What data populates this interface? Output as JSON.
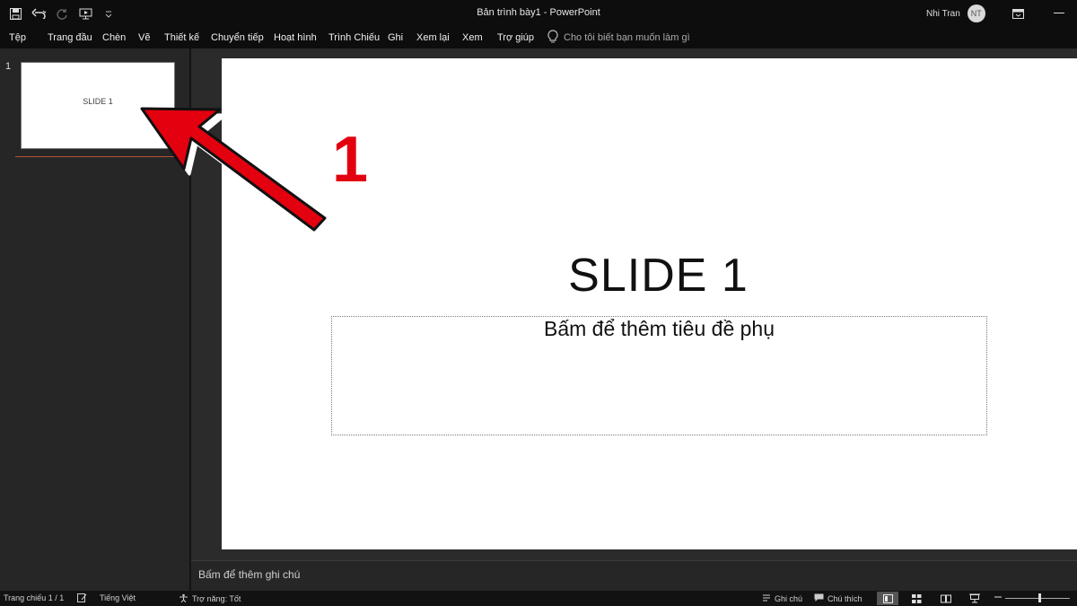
{
  "window": {
    "title": "Bản trình bày1  -  PowerPoint",
    "user_name": "Nhi Tran",
    "user_initials": "NT"
  },
  "quick_access": {
    "icons": [
      "save-icon",
      "undo-icon",
      "redo-icon",
      "start-slideshow-icon",
      "customize-icon"
    ]
  },
  "ribbon": {
    "tabs": [
      "Tệp",
      "Trang đầu",
      "Chèn",
      "Vẽ",
      "Thiết kế",
      "Chuyển tiếp",
      "Hoạt hình",
      "Trình Chiếu",
      "Ghi",
      "Xem lại",
      "Xem",
      "Trợ giúp"
    ],
    "tell_me_placeholder": "Cho tôi biết bạn muốn làm gì"
  },
  "thumbnails": [
    {
      "number": "1",
      "title": "SLIDE 1"
    }
  ],
  "slide": {
    "title": "SLIDE 1",
    "subtitle_placeholder": "Bấm để thêm tiêu đề phụ"
  },
  "notes": {
    "placeholder": "Bấm để thêm ghi chú"
  },
  "status": {
    "slide_counter": "Trang chiếu 1 / 1",
    "language": "Tiếng Việt",
    "accessibility": "Trợ năng: Tốt",
    "notes_label": "Ghi chú",
    "comments_label": "Chú thích"
  },
  "annotation": {
    "label": "1",
    "color": "#e3000f"
  },
  "colors": {
    "accent": "#b8503a",
    "background": "#0a0a0a",
    "pane": "#262626"
  }
}
